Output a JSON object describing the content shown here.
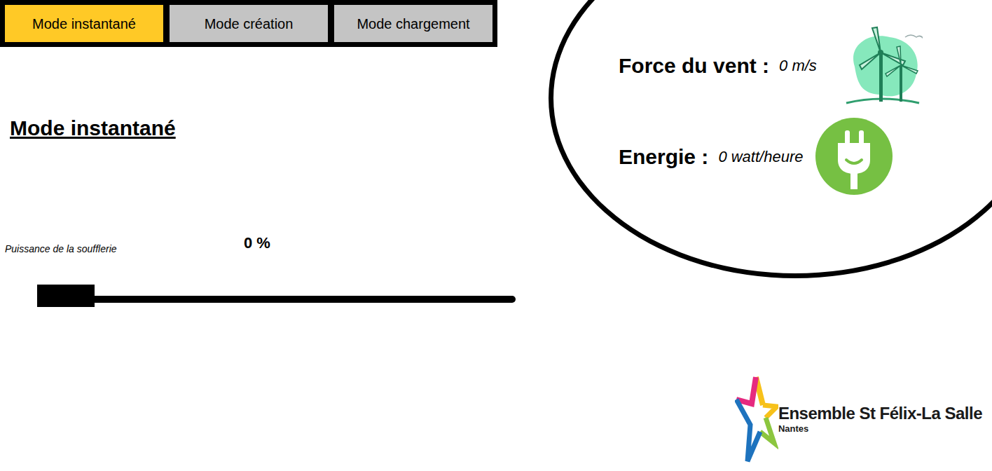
{
  "tabs": [
    {
      "label": "Mode instantané",
      "selected": true
    },
    {
      "label": "Mode création",
      "selected": false
    },
    {
      "label": "Mode chargement",
      "selected": false
    }
  ],
  "mode_title": "Mode instantané",
  "slider": {
    "label": "Puissance de la soufflerie",
    "reading": "0 %",
    "level": 0
  },
  "readings": [
    {
      "label": "Force du vent :",
      "value": "0 m/s",
      "kind": "wind"
    },
    {
      "label": "Energie :",
      "value": "0 watt/heure",
      "kind": "energy"
    }
  ],
  "logo": {
    "name": "Ensemble St Félix-La Salle",
    "city": "Nantes"
  }
}
